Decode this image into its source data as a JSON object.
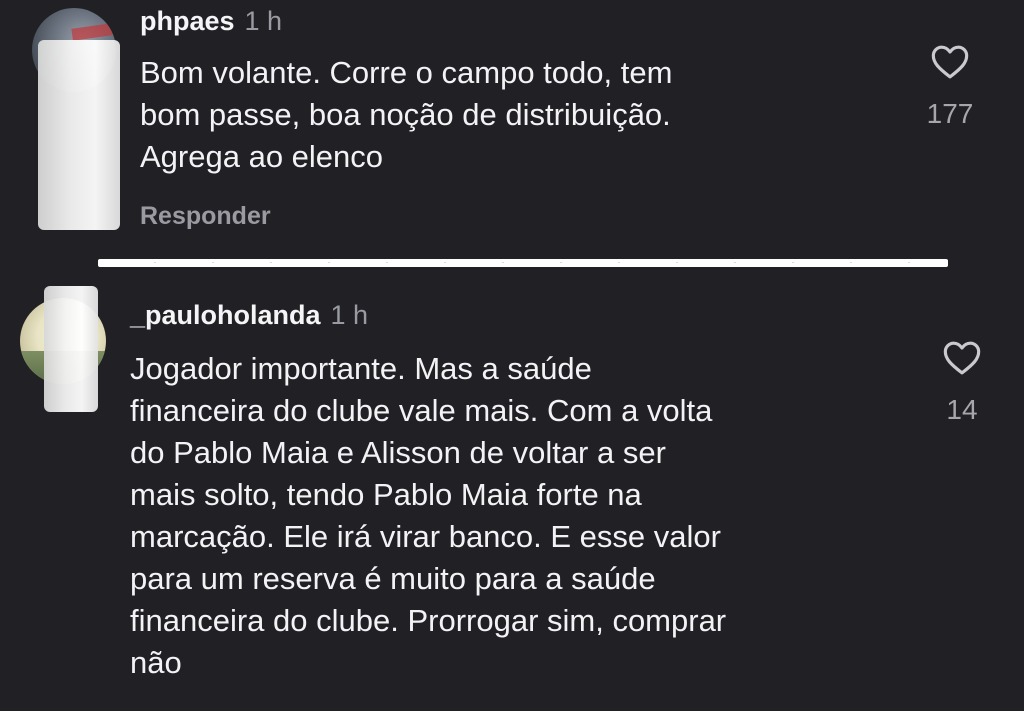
{
  "comments": [
    {
      "username": "phpaes",
      "time": "1 h",
      "text": "Bom volante. Corre o campo todo, tem\nbom passe, boa noção de distribuição.\nAgrega ao elenco",
      "reply_label": "Responder",
      "like_icon": "heart-outline-icon",
      "like_count": "177"
    },
    {
      "username": "_pauloholanda",
      "time": "1 h",
      "text": "Jogador importante. Mas a saúde\nfinanceira do clube vale mais. Com a volta\ndo Pablo Maia e Alisson de voltar a ser\nmais solto, tendo Pablo Maia forte na\nmarcação. Ele irá virar banco. E esse valor\npara um reserva é muito para a saúde\nfinanceira do clube. Prorrogar sim, comprar\nnão",
      "like_icon": "heart-outline-icon",
      "like_count": "14"
    }
  ],
  "colors": {
    "background": "#212125",
    "text": "#f3f3f5",
    "muted": "#9a9aa2"
  }
}
